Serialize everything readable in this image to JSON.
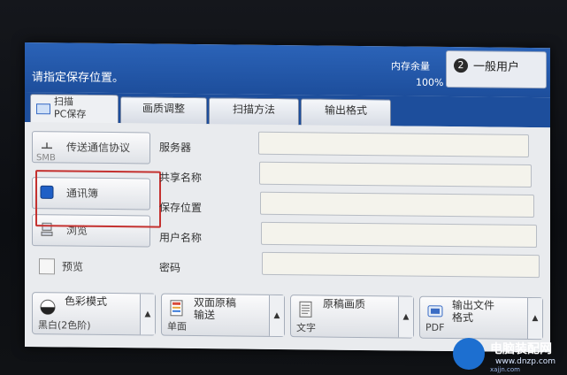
{
  "header": {
    "message": "请指定保存位置。",
    "memory_label": "内存余量",
    "memory_value": "100%",
    "user_button": "一般用户"
  },
  "tabs": [
    {
      "line1": "扫描",
      "line2": "PC保存"
    },
    {
      "label": "画质调整"
    },
    {
      "label": "扫描方法"
    },
    {
      "label": "输出格式"
    }
  ],
  "left_buttons": {
    "protocol": "传送通信协议",
    "protocol_sub": "SMB",
    "address_book": "通讯簿",
    "browse": "浏览",
    "preview": "预览"
  },
  "fields": [
    {
      "label": "服务器",
      "value": ""
    },
    {
      "label": "共享名称",
      "value": ""
    },
    {
      "label": "保存位置",
      "value": ""
    },
    {
      "label": "用户名称",
      "value": ""
    },
    {
      "label": "密码",
      "value": ""
    }
  ],
  "bottom": {
    "color_mode": {
      "label": "色彩模式",
      "value": "黑白(2色阶)"
    },
    "duplex": {
      "line1": "双面原稿",
      "line2": "输送",
      "value": "单面"
    },
    "quality": {
      "label": "原稿画质",
      "value": "文字"
    },
    "output": {
      "line1": "输出文件",
      "line2": "格式",
      "value": "PDF"
    }
  },
  "watermark": {
    "title": "电脑装配网",
    "url": "www.dnzp.com",
    "pinyin": "xajjn.com"
  },
  "colors": {
    "header_blue": "#1d4e9c",
    "highlight_red": "#c4312f",
    "field_bg": "#f4f3ec"
  }
}
